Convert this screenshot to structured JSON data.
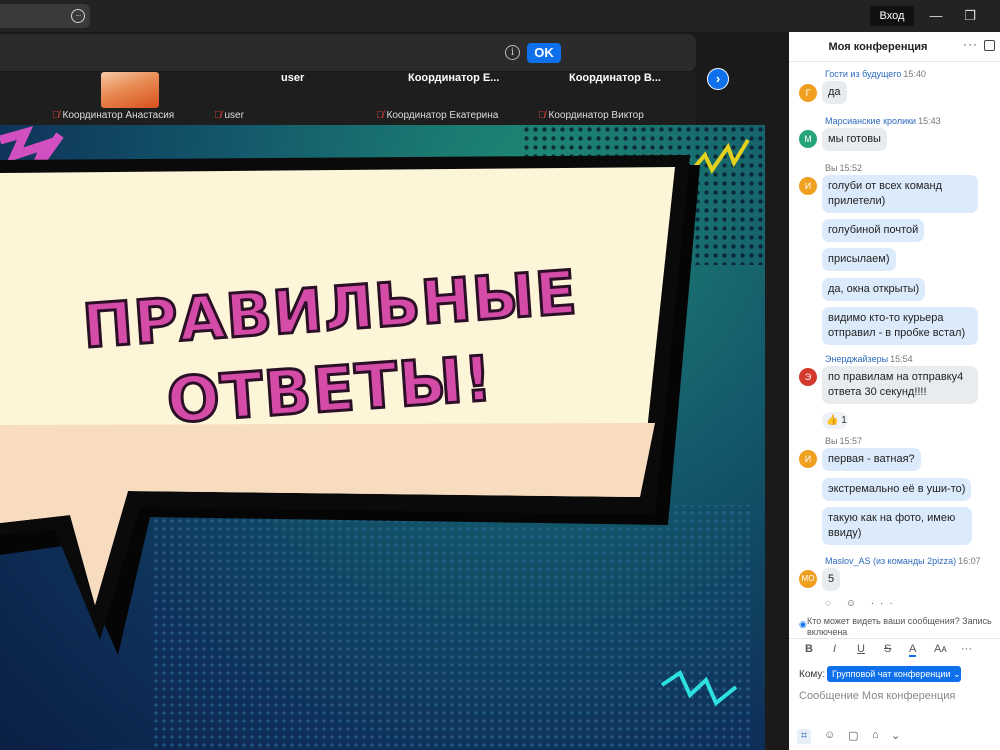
{
  "topbar": {
    "search_more": "···",
    "signin_label": "Вход",
    "minimize": "—",
    "restore": "❐"
  },
  "notice": {
    "info": "i",
    "ok_label": "OK"
  },
  "participants": [
    {
      "top_name": "",
      "label": "Координатор Анастасия"
    },
    {
      "top_name": "user",
      "label": "user"
    },
    {
      "top_name": "Координатор  Е...",
      "label": "Координатор Екатерина"
    },
    {
      "top_name": "Координатор  В...",
      "label": "Координатор Виктор"
    }
  ],
  "next_arrow": "›",
  "slide": {
    "line1": "ПРАВИЛЬНЫЕ",
    "line2": "ОТВЕТЫ!"
  },
  "chat": {
    "title": "Моя конференция",
    "more": "···",
    "messages": [
      {
        "sender": "Гости из будущего",
        "time": "15:40",
        "avatar": "Г",
        "avatar_color": "#f0a020",
        "lines": [
          "да"
        ]
      },
      {
        "sender": "Марсианские кролики",
        "time": "15:43",
        "avatar": "М",
        "avatar_color": "#27a37a",
        "lines": [
          "мы готовы"
        ]
      },
      {
        "sender": "Вы",
        "time": "15:52",
        "avatar": "И",
        "avatar_color": "#f0a020",
        "lines": [
          "голуби от всех команд прилетели)",
          "голубиной почтой",
          "присылаем)",
          "да, окна открыты)",
          "видимо кто-то курьера отправил - в пробке встал)"
        ]
      },
      {
        "sender": "Энерджайзеры",
        "time": "15:54",
        "avatar": "Э",
        "avatar_color": "#d33a2c",
        "lines": [
          "по правилам на отправку4 ответа 30 секунд!!!!"
        ],
        "reaction": "👍 1"
      },
      {
        "sender": "Вы",
        "time": "15:57",
        "avatar": "И",
        "avatar_color": "#f0a020",
        "lines": [
          "первая - ватная?",
          "экстремально её в уши-то)",
          "такую как на фото, имею ввиду)"
        ]
      },
      {
        "sender": "Maslov_AS (из команды 2pizza)",
        "time": "16:07",
        "avatar": "MО",
        "avatar_color": "#f0a020",
        "lines": [
          "5"
        ]
      }
    ],
    "msg_actions": "◌ ☺ ···",
    "who_sees": "Кто может видеть ваши сообщения? Запись включена",
    "format": {
      "bold": "B",
      "italic": "I",
      "underline": "U",
      "strike": "S",
      "color": "A",
      "size": "Aᴀ",
      "more": "···"
    },
    "to_label": "Кому:",
    "to_value": "Групповой чат конференции ⌄",
    "input_placeholder": "Сообщение Моя конференция",
    "tools": {
      "screenshot": "⌗",
      "emoji": "☺",
      "file": "▢",
      "snippet": "⌂",
      "more": "⌄"
    }
  }
}
